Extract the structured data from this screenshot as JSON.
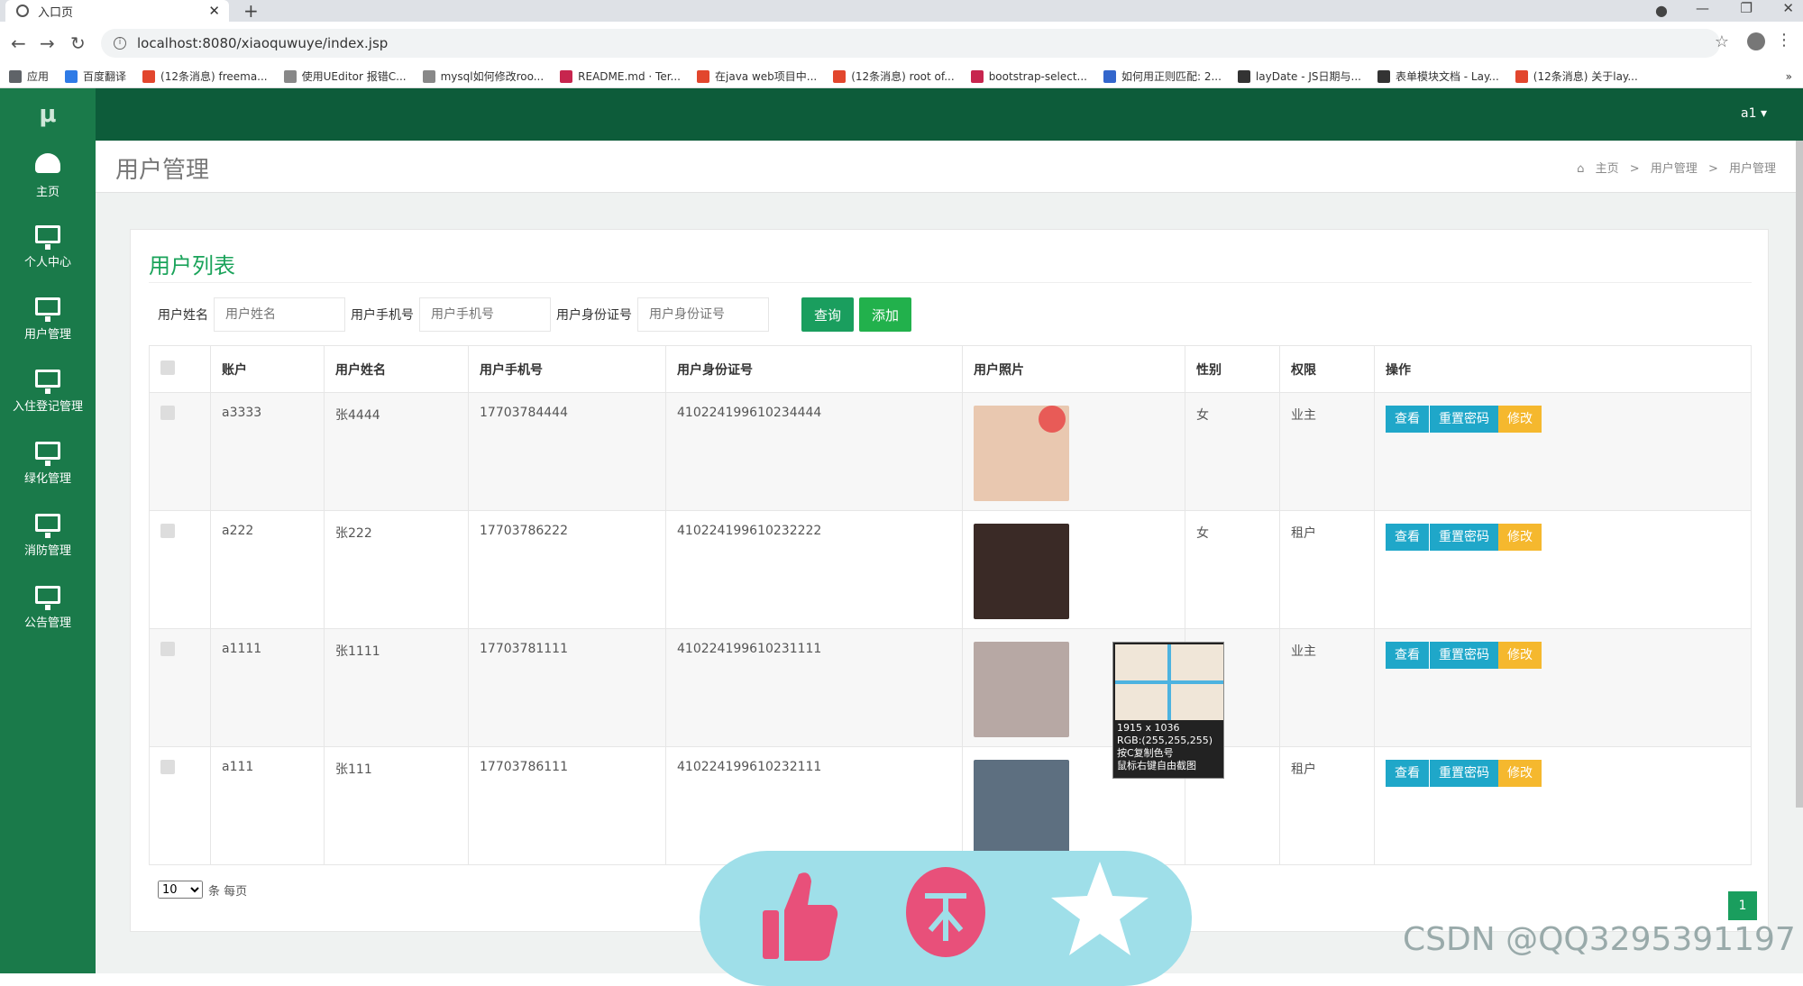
{
  "browser": {
    "tab_title": "入口页",
    "tab_close": "✕",
    "new_tab": "+",
    "url": "localhost:8080/xiaoquwuye/index.jsp",
    "info": "i",
    "star": "☆",
    "menu": "⋮",
    "back": "←",
    "forward": "→",
    "reload": "↻",
    "win_min": "—",
    "win_max": "❐",
    "win_close": "✕",
    "bookmarks": [
      {
        "label": "应用",
        "color": "#5f6368"
      },
      {
        "label": "百度翻译",
        "color": "#2f7be6"
      },
      {
        "label": "(12条消息) freema...",
        "color": "#e2462d"
      },
      {
        "label": "使用UEditor 报错C...",
        "color": "#888888"
      },
      {
        "label": "mysql如何修改roo...",
        "color": "#888888"
      },
      {
        "label": "README.md · Ter...",
        "color": "#c7254e"
      },
      {
        "label": "在java web项目中...",
        "color": "#e2462d"
      },
      {
        "label": "(12条消息) root of...",
        "color": "#e2462d"
      },
      {
        "label": "bootstrap-select...",
        "color": "#c7254e"
      },
      {
        "label": "如何用正则匹配: 2...",
        "color": "#3366cc"
      },
      {
        "label": "layDate - JS日期与...",
        "color": "#333333"
      },
      {
        "label": "表单模块文档 - Lay...",
        "color": "#333333"
      },
      {
        "label": "(12条消息) 关于lay...",
        "color": "#e2462d"
      }
    ],
    "bookmark_more": "»"
  },
  "app": {
    "logo": "μ",
    "user": "a1 ▾",
    "sidebar": [
      {
        "label": "主页",
        "icon": "dashboard-icon"
      },
      {
        "label": "个人中心",
        "icon": "monitor-icon"
      },
      {
        "label": "用户管理",
        "icon": "monitor-icon"
      },
      {
        "label": "入住登记管理",
        "icon": "monitor-icon"
      },
      {
        "label": "绿化管理",
        "icon": "monitor-icon"
      },
      {
        "label": "消防管理",
        "icon": "monitor-icon"
      },
      {
        "label": "公告管理",
        "icon": "monitor-icon"
      }
    ],
    "page_title": "用户管理",
    "breadcrumb": [
      "主页",
      "用户管理",
      "用户管理"
    ],
    "breadcrumb_sep": ">",
    "home_glyph": "⌂"
  },
  "panel": {
    "title": "用户列表",
    "search": {
      "name_label": "用户姓名",
      "name_placeholder": "用户姓名",
      "phone_label": "用户手机号",
      "phone_placeholder": "用户手机号",
      "id_label": "用户身份证号",
      "id_placeholder": "用户身份证号",
      "query": "查询",
      "add": "添加"
    },
    "columns": [
      "账户",
      "用户姓名",
      "用户手机号",
      "用户身份证号",
      "用户照片",
      "性别",
      "权限",
      "操作"
    ],
    "rows": [
      {
        "account": "a3333",
        "name": "张4444",
        "phone": "17703784444",
        "idno": "410224199610234444",
        "gender": "女",
        "role": "业主",
        "photo_color": "#e9c8b0"
      },
      {
        "account": "a222",
        "name": "张222",
        "phone": "17703786222",
        "idno": "410224199610232222",
        "gender": "女",
        "role": "租户",
        "photo_color": "#3a2a26"
      },
      {
        "account": "a1111",
        "name": "张1111",
        "phone": "17703781111",
        "idno": "410224199610231111",
        "gender": "",
        "role": "业主",
        "photo_color": "#b7a8a4"
      },
      {
        "account": "a111",
        "name": "张111",
        "phone": "17703786111",
        "idno": "410224199610232111",
        "gender": "",
        "role": "租户",
        "photo_color": "#5d6f80"
      }
    ],
    "ops": {
      "view": "查看",
      "reset": "重置密码",
      "edit": "修改"
    },
    "page_size": "10",
    "page_size_suffix": "条 每页",
    "current_page": "1"
  },
  "overlay": {
    "tip_size": "1915 x 1036",
    "tip_rgb": "RGB:(255,255,255)",
    "tip_copy": "按C复制色号",
    "tip_shot": "鼠标右键自由截图",
    "watermark": "CSDN @QQ3295391197"
  },
  "colors": {
    "sidebar": "#1a7a4a",
    "topbar": "#0d5c3a",
    "accent": "#1aa35a",
    "op_blue": "#1fa7c9",
    "op_yellow": "#f5b82e"
  }
}
